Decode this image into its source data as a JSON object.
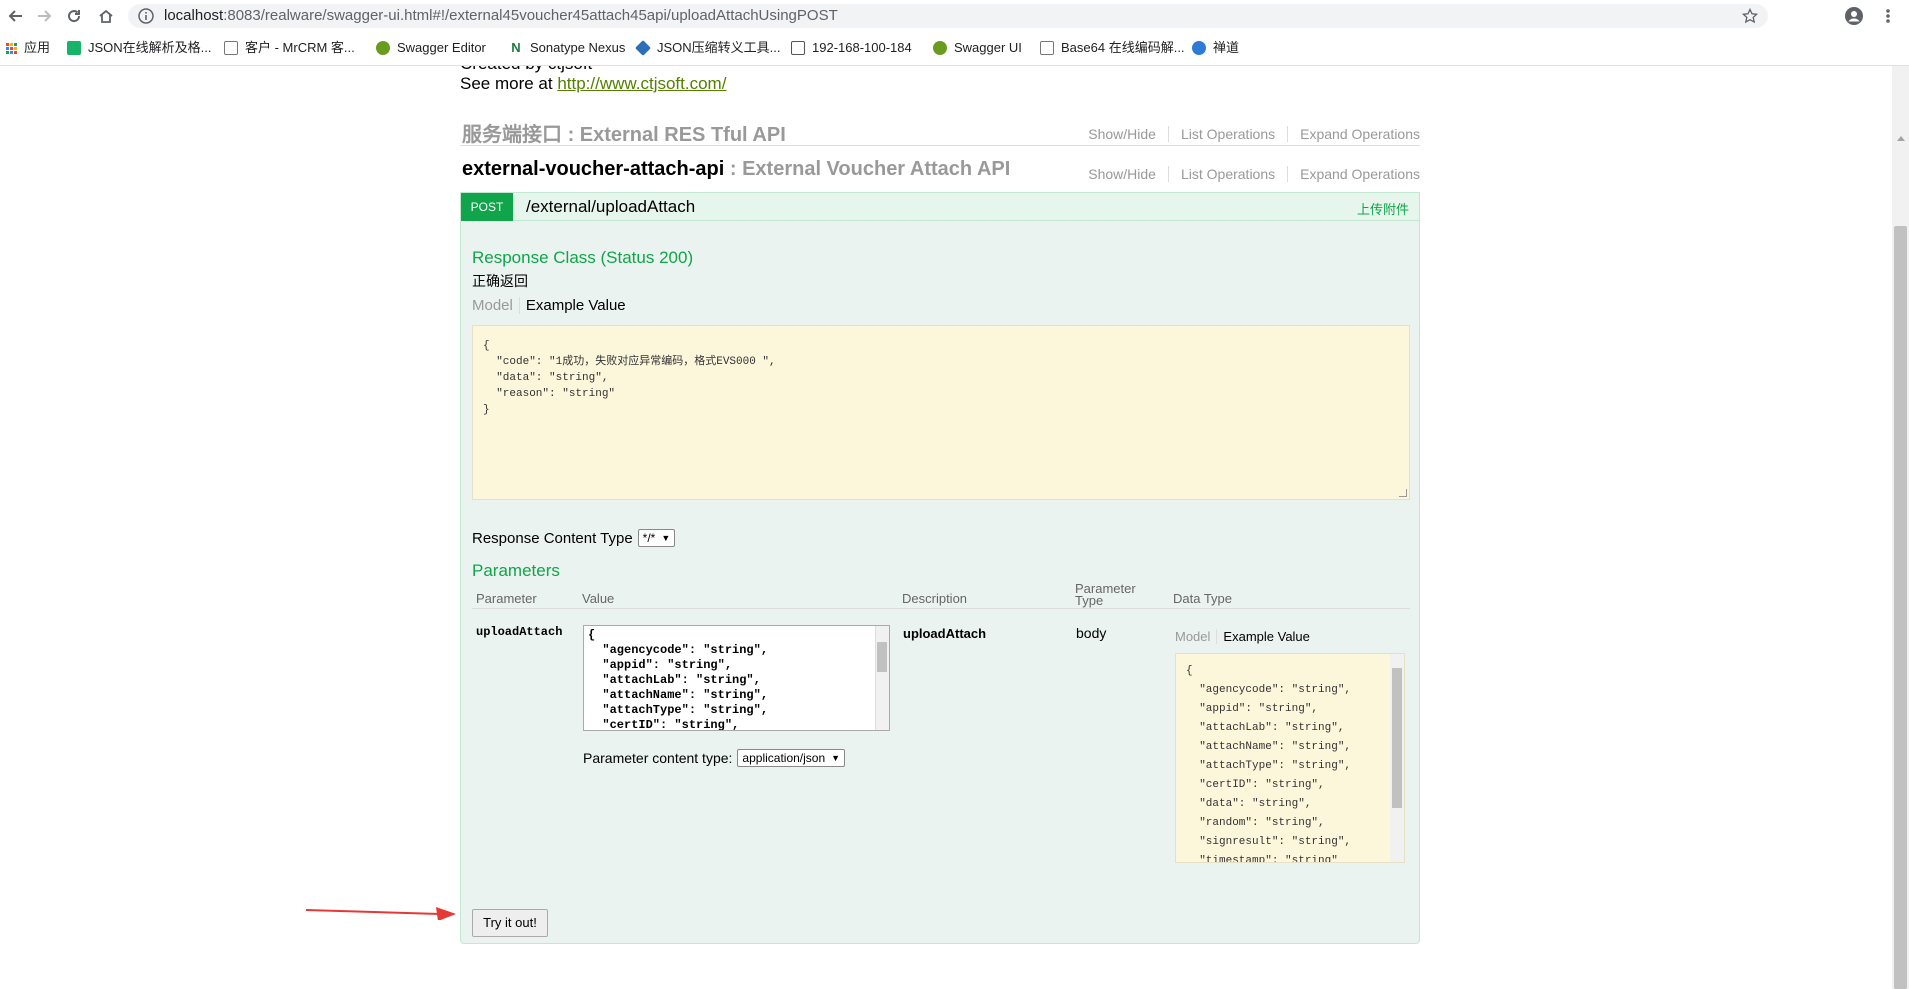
{
  "browser": {
    "url_host": "localhost",
    "url_rest": ":8083/realware/swagger-ui.html#!/external45voucher45attach45api/uploadAttachUsingPOST",
    "bookmarks": [
      {
        "label": "应用",
        "color": "#e84b2c"
      },
      {
        "label": "JSON在线解析及格...",
        "color": "#18b36a"
      },
      {
        "label": "客户 - MrCRM 客...",
        "color": "#777777"
      },
      {
        "label": "Swagger Editor",
        "color": "#6b9b1e"
      },
      {
        "label": "Sonatype Nexus",
        "color": "#1e7d3e"
      },
      {
        "label": "JSON压缩转义工具...",
        "color": "#2a6fb8"
      },
      {
        "label": "192-168-100-184",
        "color": "#555555"
      },
      {
        "label": "Swagger UI",
        "color": "#6b9b1e"
      },
      {
        "label": "Base64 在线编码解...",
        "color": "#777777"
      },
      {
        "label": "禅道",
        "color": "#2e7bd6"
      }
    ]
  },
  "info": {
    "created_by": "Created by ctjsoft",
    "see_more_prefix": "See more at ",
    "see_more_link": "http://www.ctjsoft.com/"
  },
  "groups": [
    {
      "name": "服务端接口",
      "desc": ": External RES Tful API",
      "show_hide": "Show/Hide",
      "list_ops": "List Operations",
      "expand_ops": "Expand Operations"
    },
    {
      "name": "external-voucher-attach-api",
      "desc": ": External Voucher Attach API",
      "show_hide": "Show/Hide",
      "list_ops": "List Operations",
      "expand_ops": "Expand Operations"
    }
  ],
  "operation": {
    "method": "POST",
    "path": "/external/uploadAttach",
    "summary": "上传附件",
    "response_class": "Response Class (Status 200)",
    "response_desc": "正确返回",
    "tab_model": "Model",
    "tab_example": "Example Value",
    "example_lines": [
      "{",
      "  \"code\": \"1成功，失败对应异常编码，格式EVS000 \",",
      "  \"data\": \"string\",",
      "  \"reason\": \"string\"",
      "}"
    ],
    "response_content_type_label": "Response Content Type",
    "response_content_type_value": "*/*",
    "parameters_title": "Parameters",
    "param_headers": {
      "parameter": "Parameter",
      "value": "Value",
      "description": "Description",
      "parameter_type": "Parameter Type",
      "data_type": "Data Type"
    },
    "param": {
      "name": "uploadAttach",
      "description": "uploadAttach",
      "type": "body",
      "value_lines": [
        "{",
        "  \"agencycode\": \"string\",",
        "  \"appid\": \"string\",",
        "  \"attachLab\": \"string\",",
        "  \"attachName\": \"string\",",
        "  \"attachType\": \"string\",",
        "  \"certID\": \"string\","
      ],
      "example_lines": [
        "{",
        "  \"agencycode\": \"string\",",
        "  \"appid\": \"string\",",
        "  \"attachLab\": \"string\",",
        "  \"attachName\": \"string\",",
        "  \"attachType\": \"string\",",
        "  \"certID\": \"string\",",
        "  \"data\": \"string\",",
        "  \"random\": \"string\",",
        "  \"signresult\": \"string\",",
        "  \"timestamp\": \"string\""
      ],
      "content_type_label": "Parameter content type:",
      "content_type_value": "application/json"
    },
    "try_button": "Try it out!"
  },
  "colors": {
    "post_green": "#10a54a",
    "highlight_yellow": "#fcf6db",
    "arrow_red": "#e53935"
  }
}
